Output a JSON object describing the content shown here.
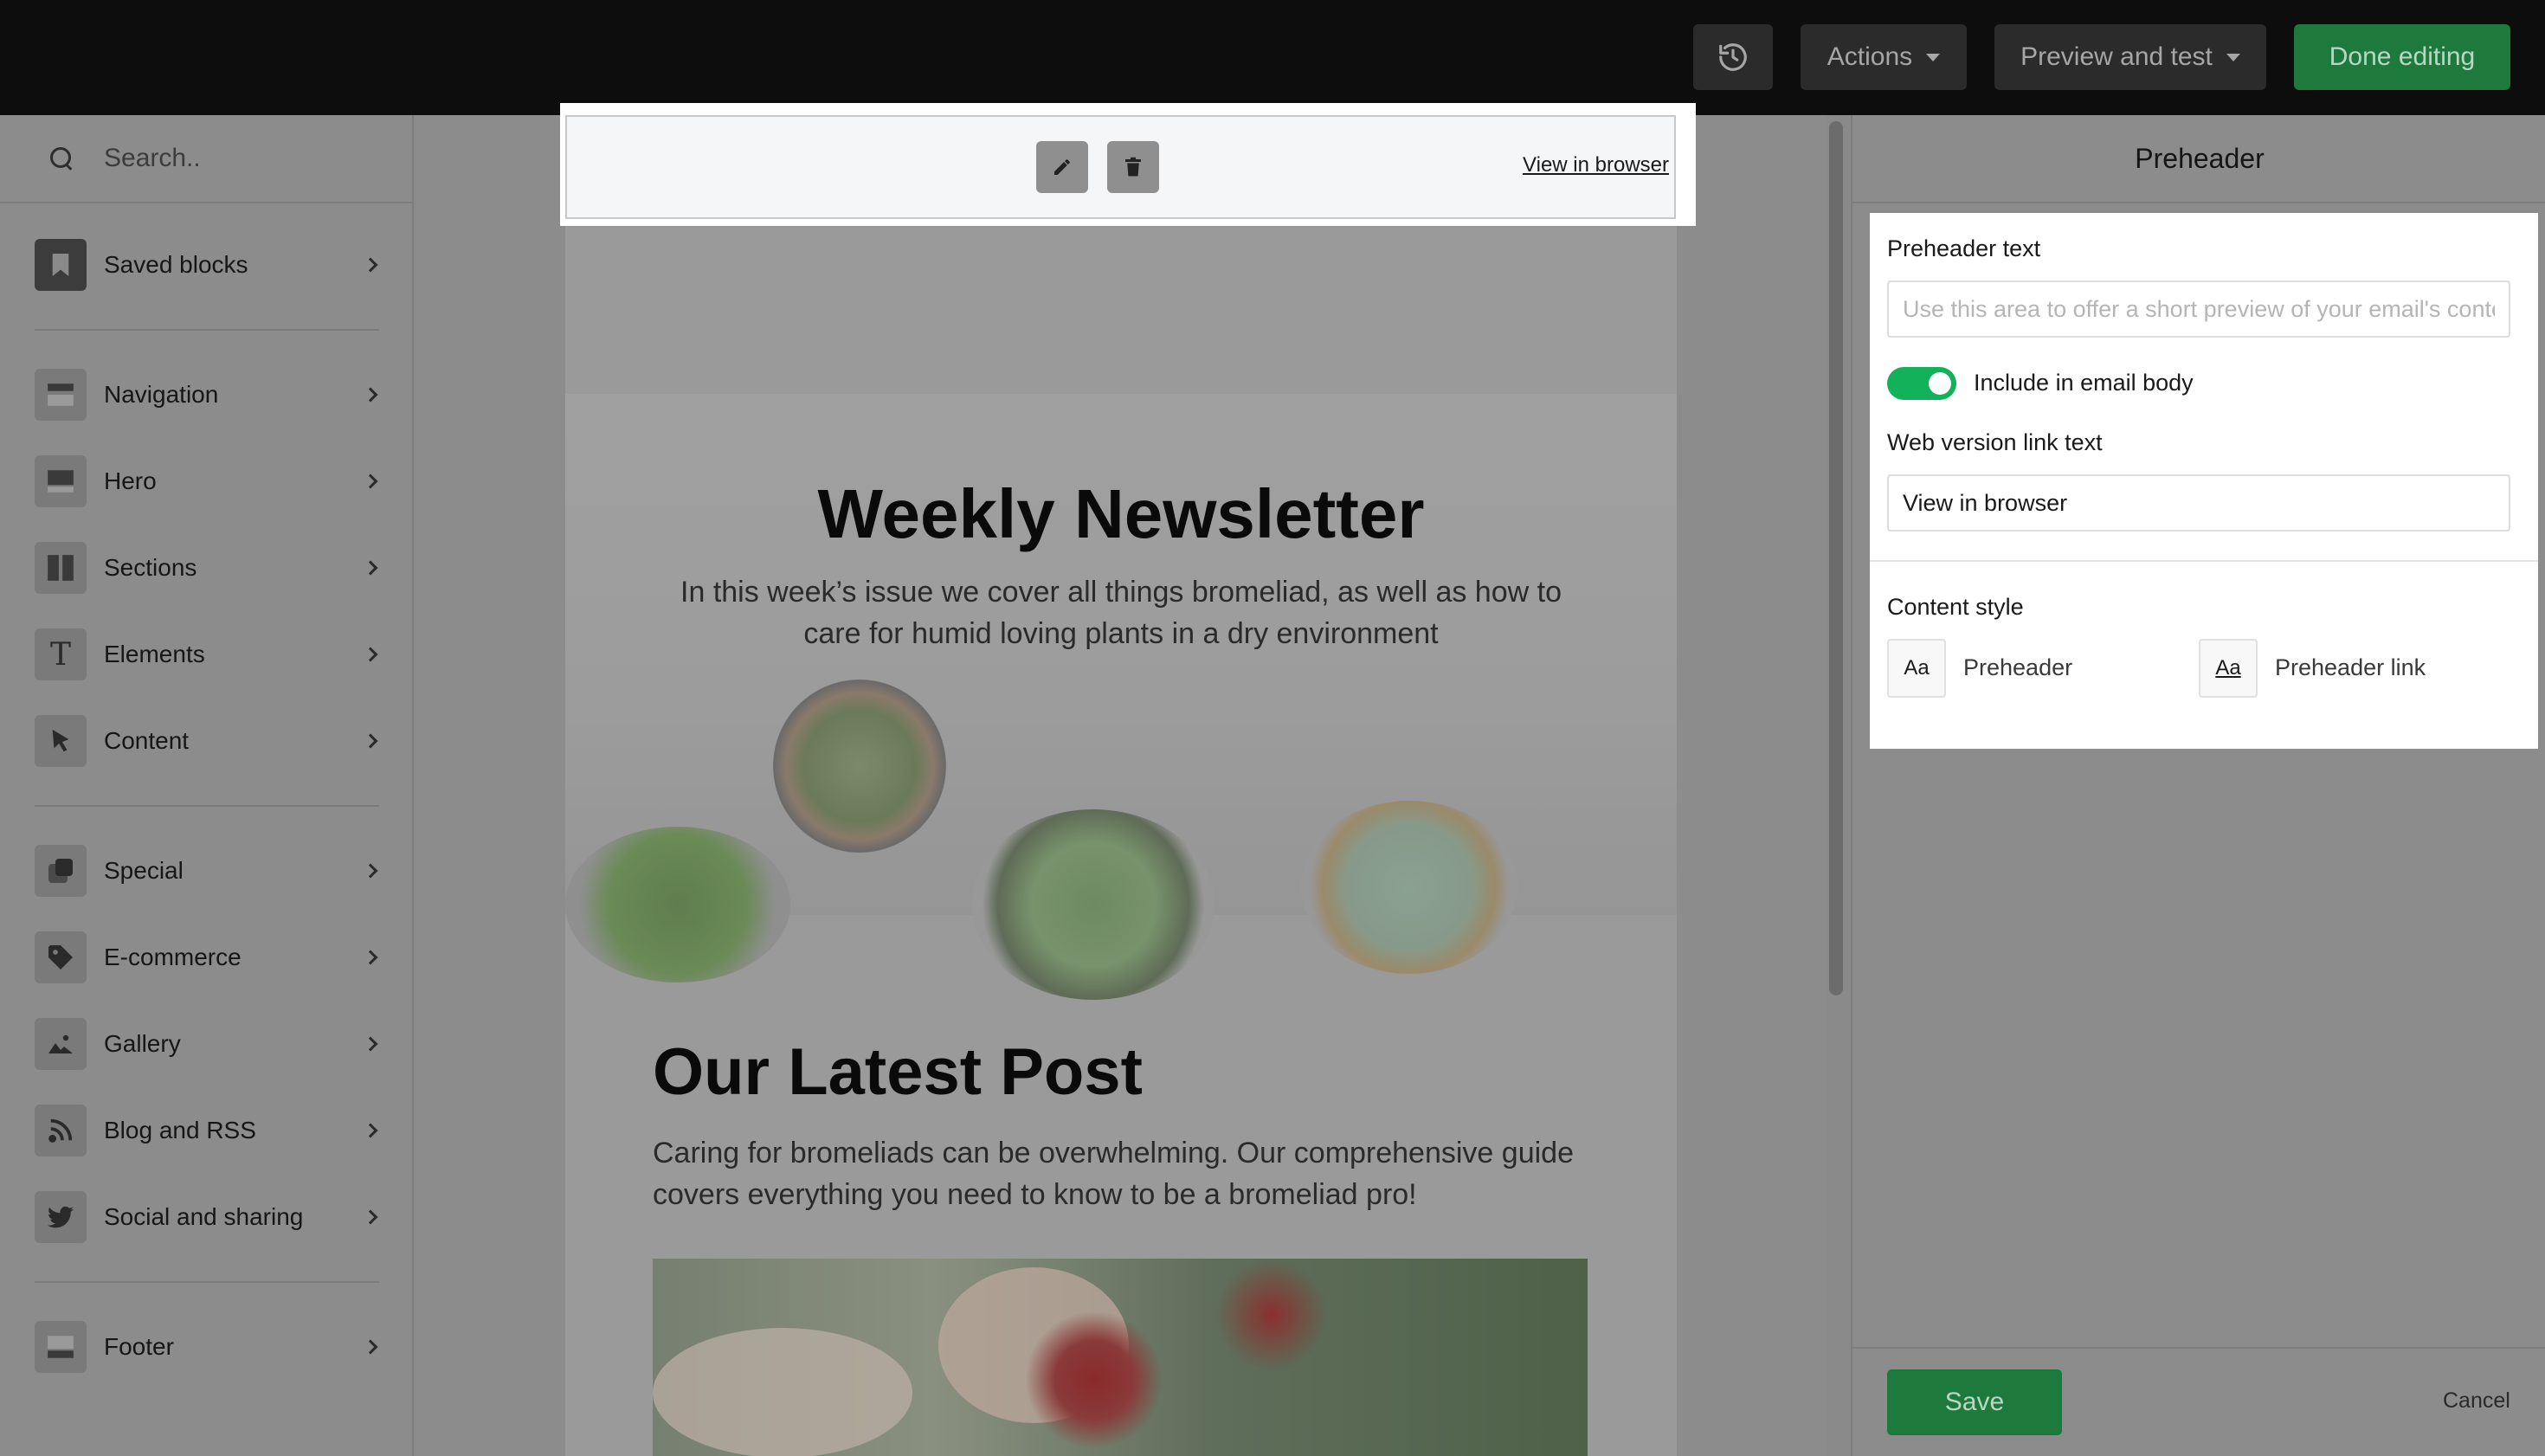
{
  "topbar": {
    "history_icon": "history-icon",
    "actions_label": "Actions",
    "preview_label": "Preview and test",
    "done_label": "Done editing",
    "done_color": "#1e7a3c"
  },
  "sidebar": {
    "search_placeholder": "Search..",
    "items": [
      {
        "label": "Saved blocks",
        "icon": "bookmark-icon"
      },
      {
        "label": "Navigation",
        "icon": "navigation-icon"
      },
      {
        "label": "Hero",
        "icon": "hero-icon"
      },
      {
        "label": "Sections",
        "icon": "sections-icon"
      },
      {
        "label": "Elements",
        "icon": "text-icon"
      },
      {
        "label": "Content",
        "icon": "cursor-icon"
      },
      {
        "label": "Special",
        "icon": "special-icon"
      },
      {
        "label": "E-commerce",
        "icon": "tag-icon"
      },
      {
        "label": "Gallery",
        "icon": "image-icon"
      },
      {
        "label": "Blog and RSS",
        "icon": "rss-icon"
      },
      {
        "label": "Social and sharing",
        "icon": "twitter-icon"
      },
      {
        "label": "Footer",
        "icon": "footer-icon"
      }
    ]
  },
  "email": {
    "preheader": {
      "view_link": "View in browser",
      "edit_icon": "pencil-icon",
      "delete_icon": "trash-icon"
    },
    "hero": {
      "title": "Weekly Newsletter",
      "subtitle": "In this week’s issue we cover all things bromeliad, as well as how to care for humid loving plants in a dry environment"
    },
    "post": {
      "title": "Our Latest Post",
      "body": "Caring for bromeliads can be overwhelming. Our comprehensive guide covers everything you need to know to be a bromeliad pro!"
    }
  },
  "panel": {
    "title": "Preheader",
    "preheader_text_label": "Preheader text",
    "preheader_text_placeholder": "Use this area to offer a short preview of your email's content",
    "preheader_text_value": "",
    "include_toggle_label": "Include in email body",
    "include_toggle_on": true,
    "toggle_color": "#12b15a",
    "web_link_label": "Web version link text",
    "web_link_value": "View in browser",
    "content_style_label": "Content style",
    "style_sample": "Aa",
    "style_preheader_label": "Preheader",
    "style_link_label": "Preheader link",
    "save_label": "Save",
    "cancel_label": "Cancel"
  }
}
